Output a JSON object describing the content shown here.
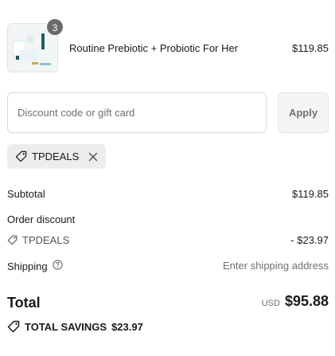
{
  "product": {
    "quantity": "3",
    "name": "Routine Prebiotic + Probiotic For Her",
    "price": "$119.85"
  },
  "discount": {
    "placeholder": "Discount code or gift card",
    "apply_label": "Apply",
    "applied_code": "TPDEALS"
  },
  "summary": {
    "subtotal_label": "Subtotal",
    "subtotal_value": "$119.85",
    "order_discount_label": "Order discount",
    "order_discount_code": "TPDEALS",
    "order_discount_value": "- $23.97",
    "shipping_label": "Shipping",
    "shipping_value": "Enter shipping address"
  },
  "total": {
    "label": "Total",
    "currency": "USD",
    "amount": "$95.88"
  },
  "savings": {
    "label": "TOTAL SAVINGS",
    "amount": "$23.97"
  },
  "icons": {
    "tag": "tag-icon",
    "remove": "close-icon",
    "info": "info-icon"
  }
}
